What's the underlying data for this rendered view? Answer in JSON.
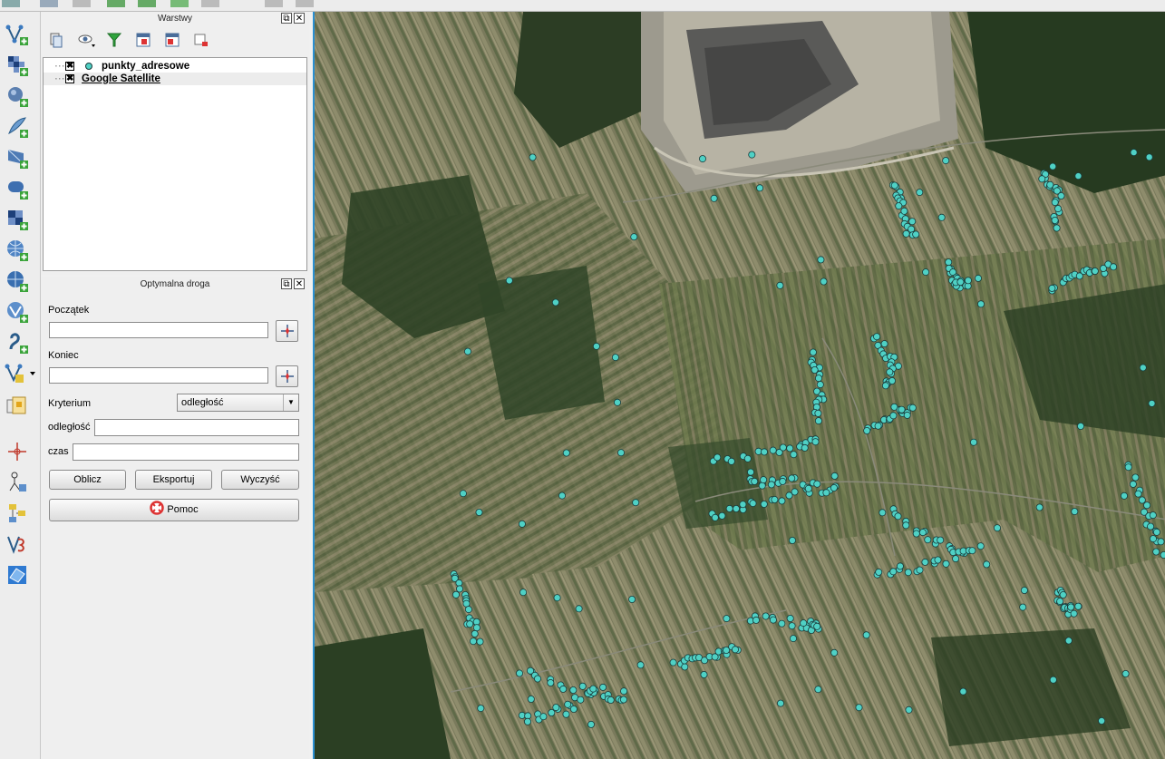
{
  "layers_panel": {
    "title": "Warstwy",
    "layers": [
      {
        "name": "punkty_adresowe",
        "checked_mark": "✖",
        "symbol_color": "#4fd1c5"
      },
      {
        "name": "Google Satellite",
        "checked_mark": "✖"
      }
    ]
  },
  "route_panel": {
    "title": "Optymalna droga",
    "start_label": "Początek",
    "end_label": "Koniec",
    "criterion_label": "Kryterium",
    "criterion_value": "odległość",
    "distance_label": "odległość",
    "time_label": "czas",
    "buttons": {
      "compute": "Oblicz",
      "export": "Eksportuj",
      "clear": "Wyczyść",
      "help": "Pomoc"
    }
  },
  "icons": {
    "toolbar": [
      "add-vector-layer-icon",
      "add-raster-layer-icon",
      "add-postgis-layer-icon",
      "add-spatialite-layer-icon",
      "add-wms-layer-icon",
      "add-mssql-layer-icon",
      "add-wcs-layer-icon",
      "add-wfs-layer-icon",
      "add-virtual-layer-icon",
      "add-delimited-text-icon",
      "new-shapefile-icon",
      "digitize-icon",
      "identify-icon",
      "node-tool-icon",
      "split-icon",
      "georeference-icon",
      "select-icon"
    ]
  },
  "colors": {
    "point_fill": "#4fd1c5",
    "point_stroke": "#1a3a3a",
    "map_border": "#2b8fd1"
  }
}
